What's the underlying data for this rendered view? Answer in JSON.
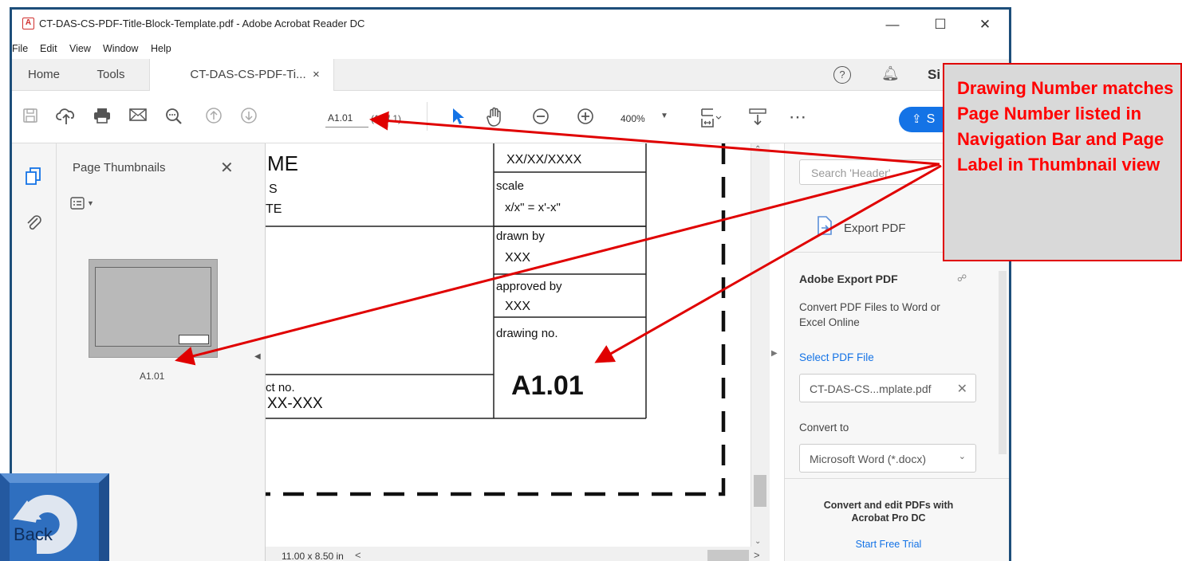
{
  "window": {
    "title": "CT-DAS-CS-PDF-Title-Block-Template.pdf - Adobe Acrobat Reader DC",
    "controls": {
      "minimize": "—",
      "maximize": "☐",
      "close": "✕"
    }
  },
  "menubar": [
    "File",
    "Edit",
    "View",
    "Window",
    "Help"
  ],
  "tabs": {
    "home": "Home",
    "tools": "Tools",
    "document": "CT-DAS-CS-PDF-Ti...",
    "close": "×",
    "signin": "Si"
  },
  "toolbar": {
    "page_value": "A1.01",
    "page_count": "(1 of 1)",
    "zoom": "400%",
    "share_label": "S",
    "icons": [
      "save-icon",
      "upload-icon",
      "print-icon",
      "email-icon",
      "zoom-search-icon",
      "prev-page-icon",
      "next-page-icon",
      "select-arrow-icon",
      "hand-icon",
      "zoom-out-icon",
      "zoom-in-icon",
      "fit-page-icon",
      "scroll-mode-icon",
      "more-icon"
    ]
  },
  "thumbnails": {
    "title": "Page Thumbnails",
    "close": "✕",
    "page_label": "A1.01"
  },
  "document": {
    "title_fragment": "ME",
    "line2": "S",
    "line3": "TE",
    "project_label": "ct no.",
    "project_value": "XX-XXX",
    "date_value": "XX/XX/XXXX",
    "scale_label": "scale",
    "scale_value": "x/x\" = x'-x\"",
    "drawn_label": "drawn by",
    "drawn_value": "XXX",
    "approved_label": "approved by",
    "approved_value": "XXX",
    "drawing_label": "drawing no.",
    "drawing_value": "A1.01",
    "page_size": "11.00 x 8.50 in"
  },
  "right_panel": {
    "search_placeholder": "Search 'Header'",
    "export_label": "Export PDF",
    "section_title": "Adobe Export PDF",
    "section_desc": "Convert PDF Files to Word or Excel Online",
    "select_link": "Select PDF File",
    "file_name": "CT-DAS-CS...mplate.pdf",
    "convert_to_label": "Convert to",
    "convert_option": "Microsoft Word (*.docx)",
    "promo_text": "Convert and edit PDFs with Acrobat Pro DC",
    "trial_link": "Start Free Trial"
  },
  "callout": {
    "text": "Drawing Number matches Page Number listed in Navigation Bar and Page Label in Thumbnail view"
  },
  "back_button": {
    "label": "Back"
  },
  "colors": {
    "window_border": "#1d4e7a",
    "accent_blue": "#1473e6",
    "callout_text": "#ff0000",
    "callout_bg": "#d9d9d9",
    "back_button": "#2f6fbf"
  }
}
